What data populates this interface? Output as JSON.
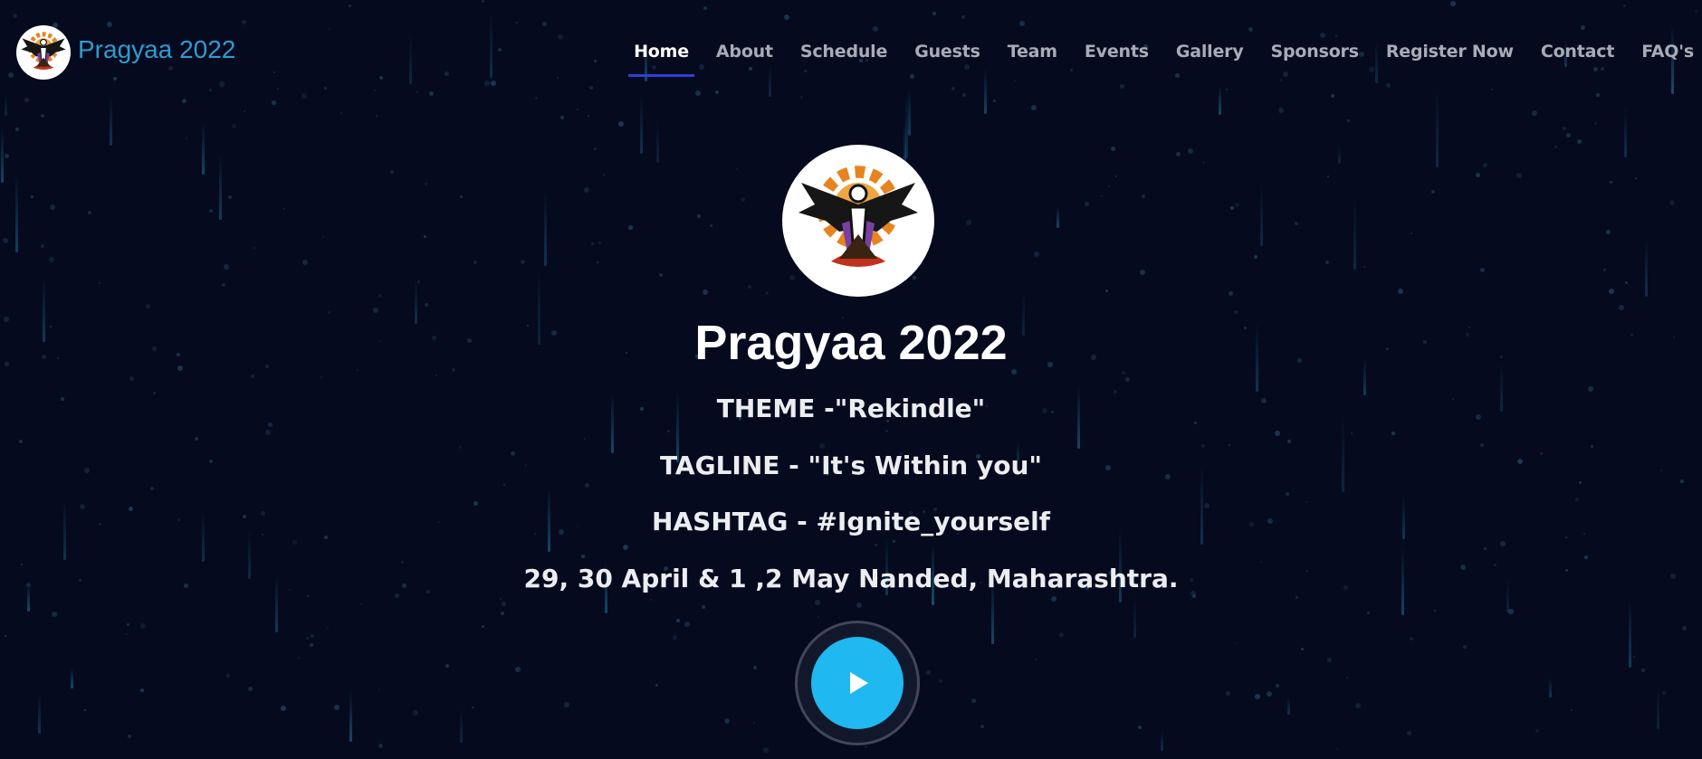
{
  "brand": {
    "title": "Pragyaa 2022",
    "logo_icon": "pragyaa-phoenix-logo-icon"
  },
  "nav": {
    "items": [
      {
        "label": "Home",
        "active": true
      },
      {
        "label": "About"
      },
      {
        "label": "Schedule"
      },
      {
        "label": "Guests"
      },
      {
        "label": "Team"
      },
      {
        "label": "Events"
      },
      {
        "label": "Gallery"
      },
      {
        "label": "Sponsors"
      },
      {
        "label": "Register Now"
      },
      {
        "label": "Contact"
      },
      {
        "label": "FAQ's"
      }
    ]
  },
  "hero": {
    "title": "Pragyaa 2022",
    "theme": "THEME -\"Rekindle\"",
    "tagline": "TAGLINE - \"It's Within you\"",
    "hashtag": "HASHTAG - #Ignite_yourself",
    "date": "29, 30 April & 1 ,2 May Nanded, Maharashtra.",
    "play_icon": "play-icon"
  },
  "colors": {
    "background": "#050a1f",
    "brand_text": "#2e9ccf",
    "nav_active_underline": "#2f3fd6",
    "play_button": "#1fb8f0"
  }
}
